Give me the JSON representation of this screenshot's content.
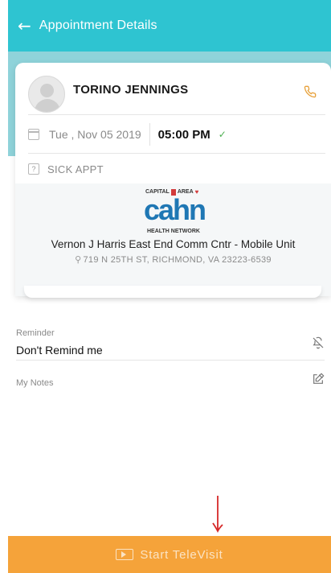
{
  "header": {
    "title": "Appointment Details",
    "back_icon": "arrow-left-icon"
  },
  "appointment": {
    "patient_name": "TORINO JENNINGS",
    "date": "Tue , Nov 05 2019",
    "time": "05:00 PM",
    "type": "SICK APPT",
    "type_icon_text": "?"
  },
  "facility": {
    "logo_top_left": "CAPITAL",
    "logo_top_right": "AREA",
    "logo_main": "cahn",
    "logo_bottom": "HEALTH NETWORK",
    "name": "Vernon J Harris East End Comm Cntr - Mobile Unit",
    "address": "719 N 25TH ST, RICHMOND, VA 23223-6539"
  },
  "reminder": {
    "label": "Reminder",
    "value": "Don't Remind me"
  },
  "notes": {
    "label": "My Notes"
  },
  "footer": {
    "button_label": "Start TeleVisit"
  },
  "colors": {
    "primary": "#2ec4d1",
    "band": "#8fd3da",
    "accent_orange": "#f5a33a",
    "check_green": "#4caf50",
    "phone_orange": "#e8a23c",
    "annotation_red": "#d62828"
  }
}
